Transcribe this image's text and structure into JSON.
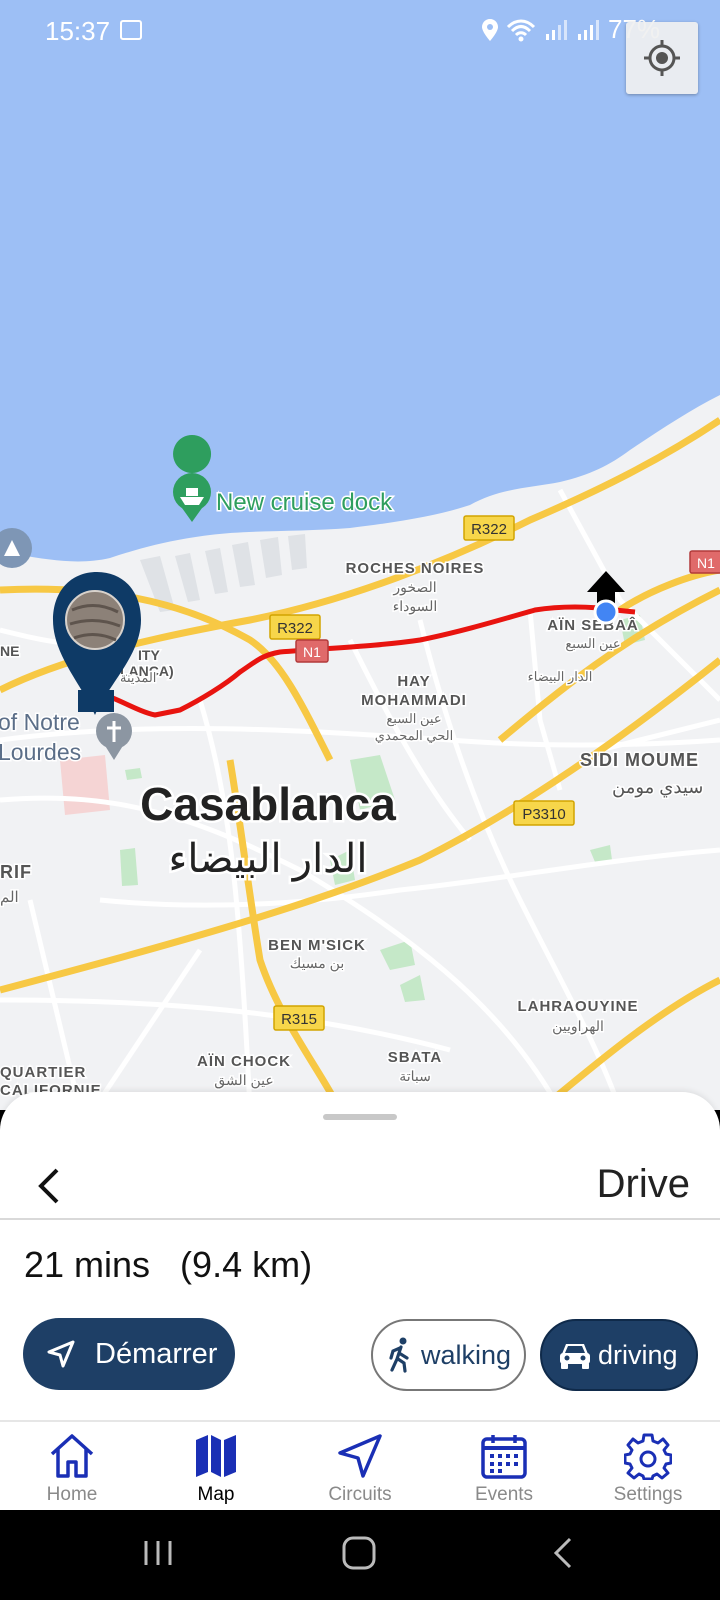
{
  "status_bar": {
    "time": "15:37",
    "battery": "77%"
  },
  "map": {
    "water_color": "#9dbff5",
    "land_color": "#f1f2f4",
    "route_color": "#e8140f",
    "labels": {
      "poi": "New cruise dock",
      "city_fr": "Casablanca",
      "city_ar": "الدار البيضاء",
      "roches_fr": "ROCHES NOIRES",
      "roches_ar1": "الصخور",
      "roches_ar2": "السوداء",
      "ain_sebaa_fr": "AÏN SEBAÂ",
      "ain_sebaa_ar": "عين السبع",
      "dar_baida_small": "الدار البيضاء",
      "hay_fr1": "HAY",
      "hay_fr2": "MOHAMMADI",
      "hay_ar1": "عين السبع",
      "hay_ar2": "الحي المحمدي",
      "sidi_fr": "SIDI MOUME",
      "sidi_ar": "سيدي مومن",
      "medina_fr1": "ITY",
      "medina_fr2": "LANCA)",
      "medina_ar": "المدينة",
      "notre1": "of Notre",
      "notre2": "Lourdes",
      "rif_fr": "RIF",
      "rif_ar": "الم",
      "bensmik_fr": "BEN M'SICK",
      "bensmik_ar": "بن مسيك",
      "lahraouyine_fr": "LAHRAOUYINE",
      "lahraouyine_ar": "الهراويين",
      "ainchock_fr": "AÏN CHOCK",
      "ainchock_ar": "عين الشق",
      "sbata_fr": "SBATA",
      "sbata_ar": "سباتة",
      "quartier1": "QUARTIER",
      "quartier2": "CALIFORNIE",
      "ne": "NE"
    },
    "road_shields": {
      "r322_a": "R322",
      "r322_b": "R322",
      "n1_a": "N1",
      "n1_b": "N1",
      "p3310": "P3310",
      "r315": "R315"
    }
  },
  "sheet": {
    "mode_title": "Drive",
    "summary": "21 mins   (9.4 km)",
    "start_label": "Démarrer",
    "walking_label": "walking",
    "driving_label": "driving",
    "accent": "#1e3f66"
  },
  "tabs": [
    {
      "label": "Home",
      "icon": "home-icon"
    },
    {
      "label": "Map",
      "icon": "map-icon"
    },
    {
      "label": "Circuits",
      "icon": "navigation-icon"
    },
    {
      "label": "Events",
      "icon": "calendar-icon"
    },
    {
      "label": "Settings",
      "icon": "gear-icon"
    }
  ]
}
